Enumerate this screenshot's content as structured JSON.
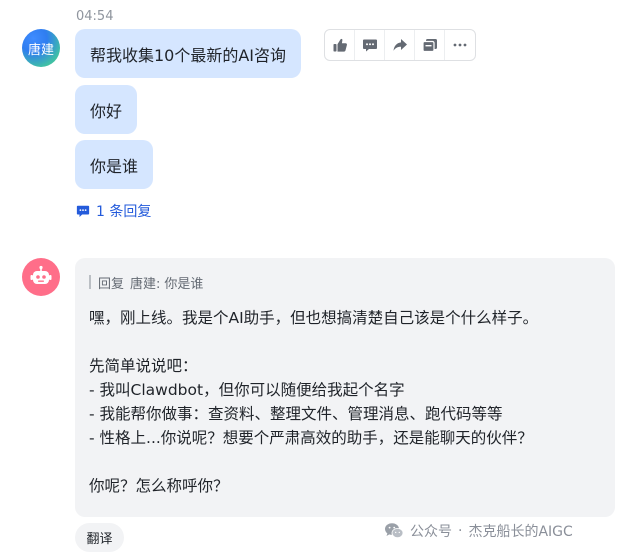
{
  "timestamp": "04:54",
  "user": {
    "avatar_text": "唐建"
  },
  "messages": [
    {
      "text": "帮我收集10个最新的AI咨询"
    },
    {
      "text": "你好"
    },
    {
      "text": "你是谁"
    }
  ],
  "toolbar": {
    "icons": [
      "thumbs-up-icon",
      "comment-icon",
      "forward-icon",
      "cards-icon",
      "more-icon"
    ]
  },
  "thread": {
    "reply_count_label": "1 条回复"
  },
  "bot": {
    "quote_prefix": "回复",
    "quote_name": "唐建:",
    "quote_text": "你是谁",
    "lines": [
      "嘿，刚上线。我是个AI助手，但也想搞清楚自己该是个什么样子。",
      "",
      "先简单说说吧：",
      "- 我叫Clawdbot，但你可以随便给我起个名字",
      "- 我能帮你做事：查资料、整理文件、管理消息、跑代码等等",
      "- 性格上...你说呢？想要个严肃高效的助手，还是能聊天的伙伴？",
      "",
      "你呢？怎么称呼你？"
    ]
  },
  "translate_label": "翻译",
  "watermark": {
    "prefix": "公众号",
    "separator": "·",
    "author": "杰克船长的AIGC"
  },
  "colors": {
    "bubble": "#d5e6ff",
    "link": "#245bdb",
    "bot_avatar": "#ff6e89",
    "card_bg": "#f2f3f5"
  }
}
